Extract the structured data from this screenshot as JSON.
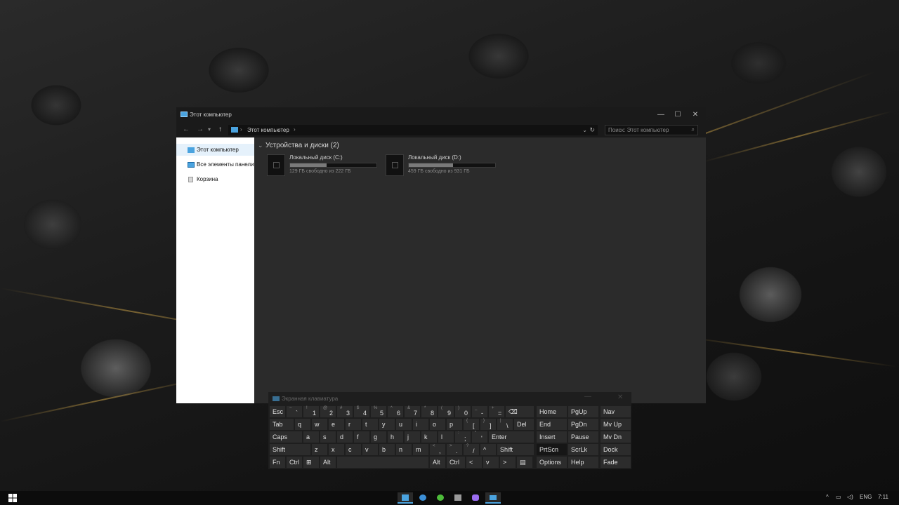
{
  "explorer": {
    "title": "Этот компьютер",
    "window_controls": {
      "minimize": "—",
      "maximize": "☐",
      "close": "✕"
    },
    "nav": {
      "back": "←",
      "forward": "→",
      "recent": "▾",
      "up": "↑"
    },
    "address": {
      "crumb": "Этот компьютер",
      "separator": "›"
    },
    "search": {
      "placeholder": "Поиск: Этот компьютер"
    },
    "sidebar": [
      {
        "label": "Этот компьютер",
        "icon": "computer-icon",
        "selected": true
      },
      {
        "label": "Все элементы панели",
        "icon": "control-panel-icon",
        "selected": false
      },
      {
        "label": "Корзина",
        "icon": "recycle-bin-icon",
        "selected": false
      }
    ],
    "group_header": "Устройства и диски (2)",
    "drives": [
      {
        "name": "Локальный диск (C:)",
        "free_text": "129 ГБ свободно из 222 ГБ",
        "used_fraction": 0.42
      },
      {
        "name": "Локальный диск (D:)",
        "free_text": "459 ГБ свободно из 931 ГБ",
        "used_fraction": 0.51
      }
    ]
  },
  "osk": {
    "title": "Экранная клавиатура",
    "rows": [
      [
        "Esc",
        "~ `",
        "! 1",
        "@ 2",
        "# 3",
        "$ 4",
        "% 5",
        "^ 6",
        "& 7",
        "* 8",
        "( 9",
        ") 0",
        "_ -",
        "+ =",
        "⌫",
        "Home",
        "PgUp",
        "Nav"
      ],
      [
        "Tab",
        "q",
        "w",
        "e",
        "r",
        "t",
        "y",
        "u",
        "i",
        "o",
        "p",
        "{ [",
        "} ]",
        "| \\",
        "Del",
        "End",
        "PgDn",
        "Mv Up"
      ],
      [
        "Caps",
        "a",
        "s",
        "d",
        "f",
        "g",
        "h",
        "j",
        "k",
        "l",
        ": ;",
        "\" '",
        "Enter",
        "Insert",
        "Pause",
        "Mv Dn"
      ],
      [
        "Shift",
        "z",
        "x",
        "c",
        "v",
        "b",
        "n",
        "m",
        "< ,",
        "> .",
        "? /",
        "^",
        "Shift",
        "PrtScn",
        "ScrLk",
        "Dock"
      ],
      [
        "Fn",
        "Ctrl",
        "⊞",
        "Alt",
        "",
        "Alt",
        "Ctrl",
        "<",
        "v",
        ">",
        "▤",
        "Options",
        "Help",
        "Fade"
      ]
    ]
  },
  "taskbar": {
    "start": "windows-logo-icon",
    "apps": [
      "this-pc-icon",
      "edge-icon",
      "utorrent-icon",
      "media-icon",
      "gamepad-icon",
      "keyboard-icon"
    ],
    "tray": {
      "chevron": "^",
      "lang": "ENG",
      "time": "7:11"
    }
  }
}
